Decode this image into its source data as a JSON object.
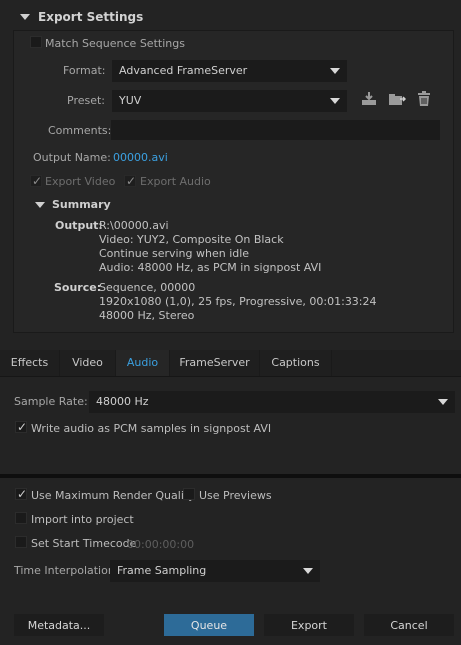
{
  "export_settings": {
    "header": "Export Settings",
    "match_sequence": "Match Sequence Settings",
    "format_label": "Format:",
    "format_value": "Advanced FrameServer",
    "preset_label": "Preset:",
    "preset_value": "YUV",
    "comments_label": "Comments:",
    "comments_value": "",
    "output_name_label": "Output Name:",
    "output_name_value": "00000.avi",
    "export_video": "Export Video",
    "export_audio": "Export Audio"
  },
  "summary": {
    "header": "Summary",
    "output_label": "Output:",
    "output_lines": [
      "R:\\00000.avi",
      "Video: YUY2, Composite On Black",
      "Continue serving when idle",
      "Audio: 48000 Hz, as PCM in signpost AVI"
    ],
    "source_label": "Source:",
    "source_lines": [
      "Sequence, 00000",
      "1920x1080 (1,0), 25 fps, Progressive, 00:01:33:24",
      "48000 Hz, Stereo"
    ]
  },
  "tabs": {
    "effects": "Effects",
    "video": "Video",
    "audio": "Audio",
    "frameserver": "FrameServer",
    "captions": "Captions",
    "active": "Audio"
  },
  "audio_panel": {
    "sample_rate_label": "Sample Rate:",
    "sample_rate_value": "48000 Hz",
    "write_pcm": "Write audio as PCM samples in signpost AVI"
  },
  "bottom": {
    "max_render_quality": "Use Maximum Render Quality",
    "use_previews": "Use Previews",
    "import_into_project": "Import into project",
    "set_start_timecode": "Set Start Timecode",
    "timecode_value": "00:00:00:00",
    "time_interp_label": "Time Interpolation:",
    "time_interp_value": "Frame Sampling"
  },
  "buttons": {
    "metadata": "Metadata...",
    "queue": "Queue",
    "export": "Export",
    "cancel": "Cancel"
  },
  "colors": {
    "accent": "#3ba0e0",
    "queue_bg": "#2d6b98"
  }
}
